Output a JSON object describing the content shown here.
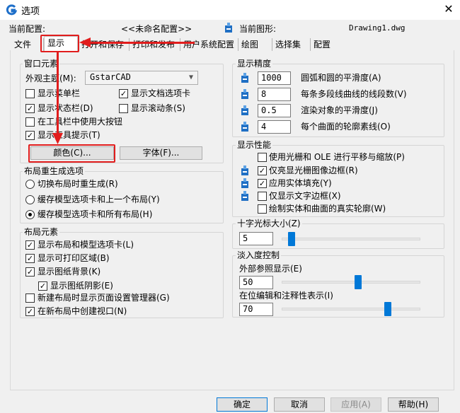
{
  "window": {
    "title": "选项",
    "close_glyph": "✕",
    "icon": "gstarcad-logo-icon"
  },
  "info": {
    "current_profile_label": "当前配置:",
    "current_profile_value": "<<未命名配置>>",
    "current_drawing_label": "当前图形:",
    "current_drawing_value": "Drawing1.dwg"
  },
  "tabs": [
    "文件",
    "显示",
    "打开和保存",
    "打印和发布",
    "用户系统配置",
    "绘图",
    "选择集",
    "配置"
  ],
  "active_tab": "显示",
  "window_elements": {
    "title": "窗口元素",
    "theme_label": "外观主题(M):",
    "theme_value": "GstarCAD",
    "checkboxes": [
      {
        "label": "显示菜单栏",
        "checked": false
      },
      {
        "label": "显示文档选项卡",
        "checked": true
      },
      {
        "label": "显示状态栏(D)",
        "checked": true
      },
      {
        "label": "显示滚动条(S)",
        "checked": false
      },
      {
        "label": "在工具栏中使用大按钮",
        "checked": false
      },
      {
        "label": "显示工具提示(T)",
        "checked": true
      }
    ],
    "colors_button": "颜色(C)...",
    "fonts_button": "字体(F)..."
  },
  "layout_regen": {
    "title": "布局重生成选项",
    "radios": [
      {
        "label": "切换布局时重生成(R)",
        "checked": false
      },
      {
        "label": "缓存模型选项卡和上一个布局(Y)",
        "checked": false
      },
      {
        "label": "缓存模型选项卡和所有布局(H)",
        "checked": true
      }
    ]
  },
  "layout_elements": {
    "title": "布局元素",
    "checkboxes": [
      {
        "label": "显示布局和模型选项卡(L)",
        "checked": true
      },
      {
        "label": "显示可打印区域(B)",
        "checked": true
      },
      {
        "label": "显示图纸背景(K)",
        "checked": true
      },
      {
        "label": "显示图纸阴影(E)",
        "checked": true
      },
      {
        "label": "新建布局时显示页面设置管理器(G)",
        "checked": false
      },
      {
        "label": "在新布局中创建视口(N)",
        "checked": true
      }
    ]
  },
  "display_resolution": {
    "title": "显示精度",
    "rows": [
      {
        "value": "1000",
        "label": "圆弧和圆的平滑度(A)"
      },
      {
        "value": "8",
        "label": "每条多段线曲线的线段数(V)"
      },
      {
        "value": "0.5",
        "label": "渲染对象的平滑度(J)"
      },
      {
        "value": "4",
        "label": "每个曲面的轮廓素线(O)"
      }
    ]
  },
  "display_performance": {
    "title": "显示性能",
    "checkboxes": [
      {
        "label": "使用光栅和 OLE 进行平移与缩放(P)",
        "checked": false
      },
      {
        "label": "仅亮显光栅图像边框(R)",
        "checked": true
      },
      {
        "label": "应用实体填充(Y)",
        "checked": true
      },
      {
        "label": "仅显示文字边框(X)",
        "checked": false
      },
      {
        "label": "绘制实体和曲面的真实轮廓(W)",
        "checked": false
      }
    ]
  },
  "crosshair": {
    "title": "十字光标大小(Z)",
    "value": "5",
    "level": 5
  },
  "fade_control": {
    "title": "淡入度控制",
    "xref_label": "外部参照显示(E)",
    "xref_value": "50",
    "xref_level": 50,
    "inplace_label": "在位编辑和注释性表示(I)",
    "inplace_value": "70",
    "inplace_level": 70
  },
  "buttons": {
    "ok": "确定",
    "cancel": "取消",
    "apply": "应用(A)",
    "help": "帮助(H)"
  },
  "colors": {
    "accent": "#0078d7",
    "annotation": "#e11d1d"
  }
}
